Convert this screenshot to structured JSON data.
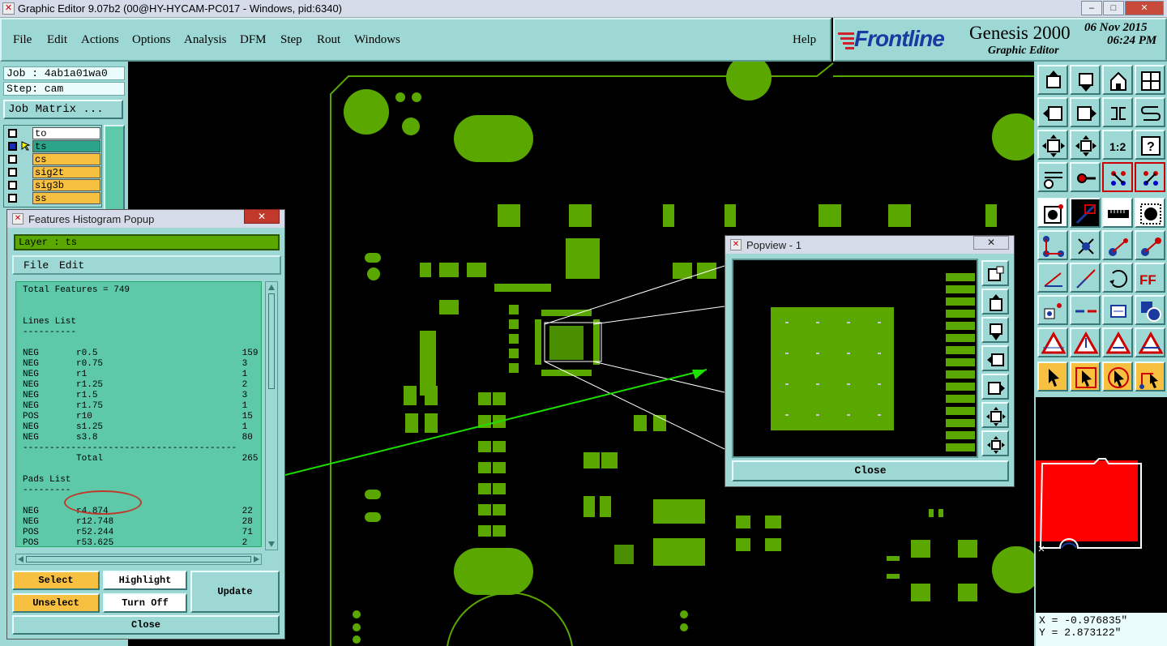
{
  "window": {
    "title": "Graphic Editor 9.07b2 (00@HY-HYCAM-PC017 - Windows, pid:6340)",
    "min_label": "–",
    "max_label": "□",
    "close_label": "✕"
  },
  "menu": {
    "items": [
      "File",
      "Edit",
      "Actions",
      "Options",
      "Analysis",
      "DFM",
      "Step",
      "Rout",
      "Windows"
    ],
    "help": "Help"
  },
  "brand": {
    "logo": "Frontline",
    "product": "Genesis 2000",
    "subtitle": "Graphic Editor",
    "date": "06 Nov 2015",
    "time": "06:24 PM"
  },
  "left": {
    "job": "Job : 4ab1a01wa0",
    "step": "Step: cam",
    "job_matrix": "Job Matrix ...",
    "layers": [
      {
        "name": "to",
        "color": "#ffffff"
      },
      {
        "name": "ts",
        "color": "#2aa58a"
      },
      {
        "name": "cs",
        "color": "#f8c040"
      },
      {
        "name": "sig2t",
        "color": "#f8c040"
      },
      {
        "name": "sig3b",
        "color": "#f8c040"
      },
      {
        "name": "ss",
        "color": "#f8c040"
      }
    ]
  },
  "histogram": {
    "title": "Features Histogram Popup",
    "layer_label": "Layer :  ts",
    "menu_file": "File",
    "menu_edit": "Edit",
    "lines": [
      "Total Features = 749",
      "",
      "",
      "Lines List",
      "----------",
      "",
      "NEG       r0.5                           159",
      "NEG       r0.75                          3",
      "NEG       r1                             1",
      "NEG       r1.25                          2",
      "NEG       r1.5                           3",
      "NEG       r1.75                          1",
      "POS       r10                            15",
      "NEG       s1.25                          1",
      "NEG       s3.8                           80",
      "----------------------------------------",
      "          Total                          265",
      "",
      "Pads List",
      "---------",
      "",
      "NEG       r4.874                         22",
      "NEG       r12.748                        28",
      "POS       r52.244                        71",
      "POS       r53.625                        2"
    ],
    "btn_select": "Select",
    "btn_highlight": "Highlight",
    "btn_update": "Update",
    "btn_unselect": "Unselect",
    "btn_turnoff": "Turn Off",
    "btn_close": "Close"
  },
  "popview": {
    "title": "Popview - 1",
    "close": "Close"
  },
  "coords": {
    "x": "X = -0.976835\"",
    "y": "Y = 2.873122\""
  },
  "colors": {
    "panel": "#9ed8d4",
    "copper": "#5aa700",
    "selected_layer": "#2aa58a",
    "layer_tab": "#f8c040",
    "map_fill": "#ff0000"
  }
}
